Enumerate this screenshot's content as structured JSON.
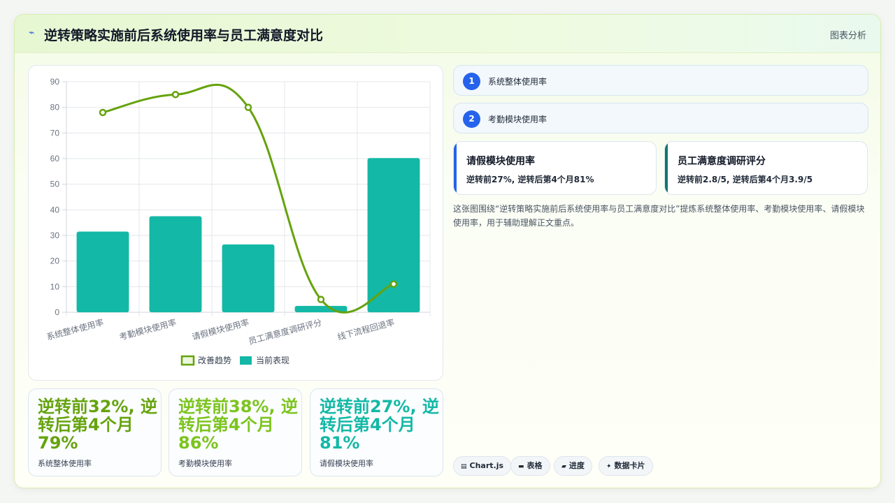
{
  "header": {
    "icon": "line-chart-icon",
    "title": "逆转策略实施前后系统使用率与员工满意度对比",
    "tag": "图表分析"
  },
  "chart_data": {
    "type": "bar",
    "categories": [
      "系统整体使用率",
      "考勤模块使用率",
      "请假模块使用率",
      "员工满意度调研评分",
      "线下流程回退率"
    ],
    "series": [
      {
        "name": "改善趋势",
        "kind": "line",
        "values": [
          78,
          85,
          80,
          5,
          11
        ],
        "color": "#65a30d"
      },
      {
        "name": "当前表现",
        "kind": "bar",
        "values": [
          31.5,
          37.5,
          26.5,
          2.5,
          60.2
        ],
        "color": "#14b8a6"
      }
    ],
    "ylim": [
      0,
      90
    ],
    "yticks": [
      "0",
      "10",
      "20",
      "30",
      "40",
      "50",
      "60",
      "70",
      "80",
      "90"
    ],
    "grid": true,
    "legend_position": "bottom"
  },
  "stats": [
    {
      "value": "逆转前32%, 逆转后第4个月79%",
      "label": "系统整体使用率"
    },
    {
      "value": "逆转前38%, 逆转后第4个月86%",
      "label": "考勤模块使用率"
    },
    {
      "value": "逆转前27%, 逆转后第4个月81%",
      "label": "请假模块使用率"
    }
  ],
  "pills": [
    {
      "num": "1",
      "label": "系统整体使用率"
    },
    {
      "num": "2",
      "label": "考勤模块使用率"
    }
  ],
  "info_cards": [
    {
      "title": "请假模块使用率",
      "detail": "逆转前27%, 逆转后第4个月81%"
    },
    {
      "title": "员工满意度调研评分",
      "detail": "逆转前2.8/5, 逆转后第4个月3.9/5"
    }
  ],
  "description": "这张图围绕“逆转策略实施前后系统使用率与员工满意度对比”提炼系统整体使用率、考勤模块使用率、请假模块使用率，用于辅助理解正文重点。",
  "chips": [
    {
      "icon": "chart-icon",
      "glyph": "▤",
      "label": "Chart.js"
    },
    {
      "icon": "table-icon",
      "glyph": "▬",
      "label": "表格"
    },
    {
      "icon": "progress-icon",
      "glyph": "▰",
      "label": "进度"
    },
    {
      "icon": "sparkle-icon",
      "glyph": "✦",
      "label": "数据卡片"
    }
  ]
}
